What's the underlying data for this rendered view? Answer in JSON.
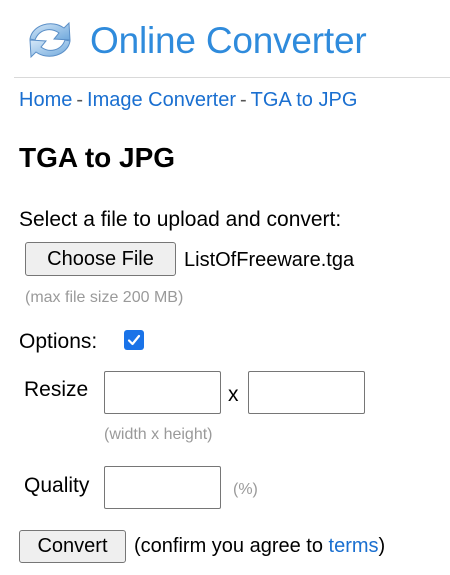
{
  "header": {
    "site_title": "Online Converter",
    "logo_icon": "refresh-arrows-icon",
    "brand_color": "#2f8bdc"
  },
  "breadcrumb": {
    "items": [
      "Home",
      "Image Converter",
      "TGA to JPG"
    ],
    "separator": "-",
    "link_color": "#1a6fd0"
  },
  "page": {
    "heading": "TGA to JPG"
  },
  "upload": {
    "prompt": "Select a file to upload and convert:",
    "choose_button": "Choose File",
    "selected_file": "ListOfFreeware.tga",
    "size_hint": "(max file size 200 MB)"
  },
  "options": {
    "label": "Options:",
    "checked": true,
    "checkbox_color": "#1a73e8",
    "resize_label": "Resize",
    "times": "x",
    "width_value": "",
    "height_value": "",
    "dims_hint": "(width x height)",
    "quality_label": "Quality",
    "quality_value": "",
    "percent_hint": "(%)"
  },
  "submit": {
    "button": "Convert",
    "confirm_prefix": "(confirm you agree to ",
    "terms_link": "terms",
    "confirm_suffix": ")"
  }
}
